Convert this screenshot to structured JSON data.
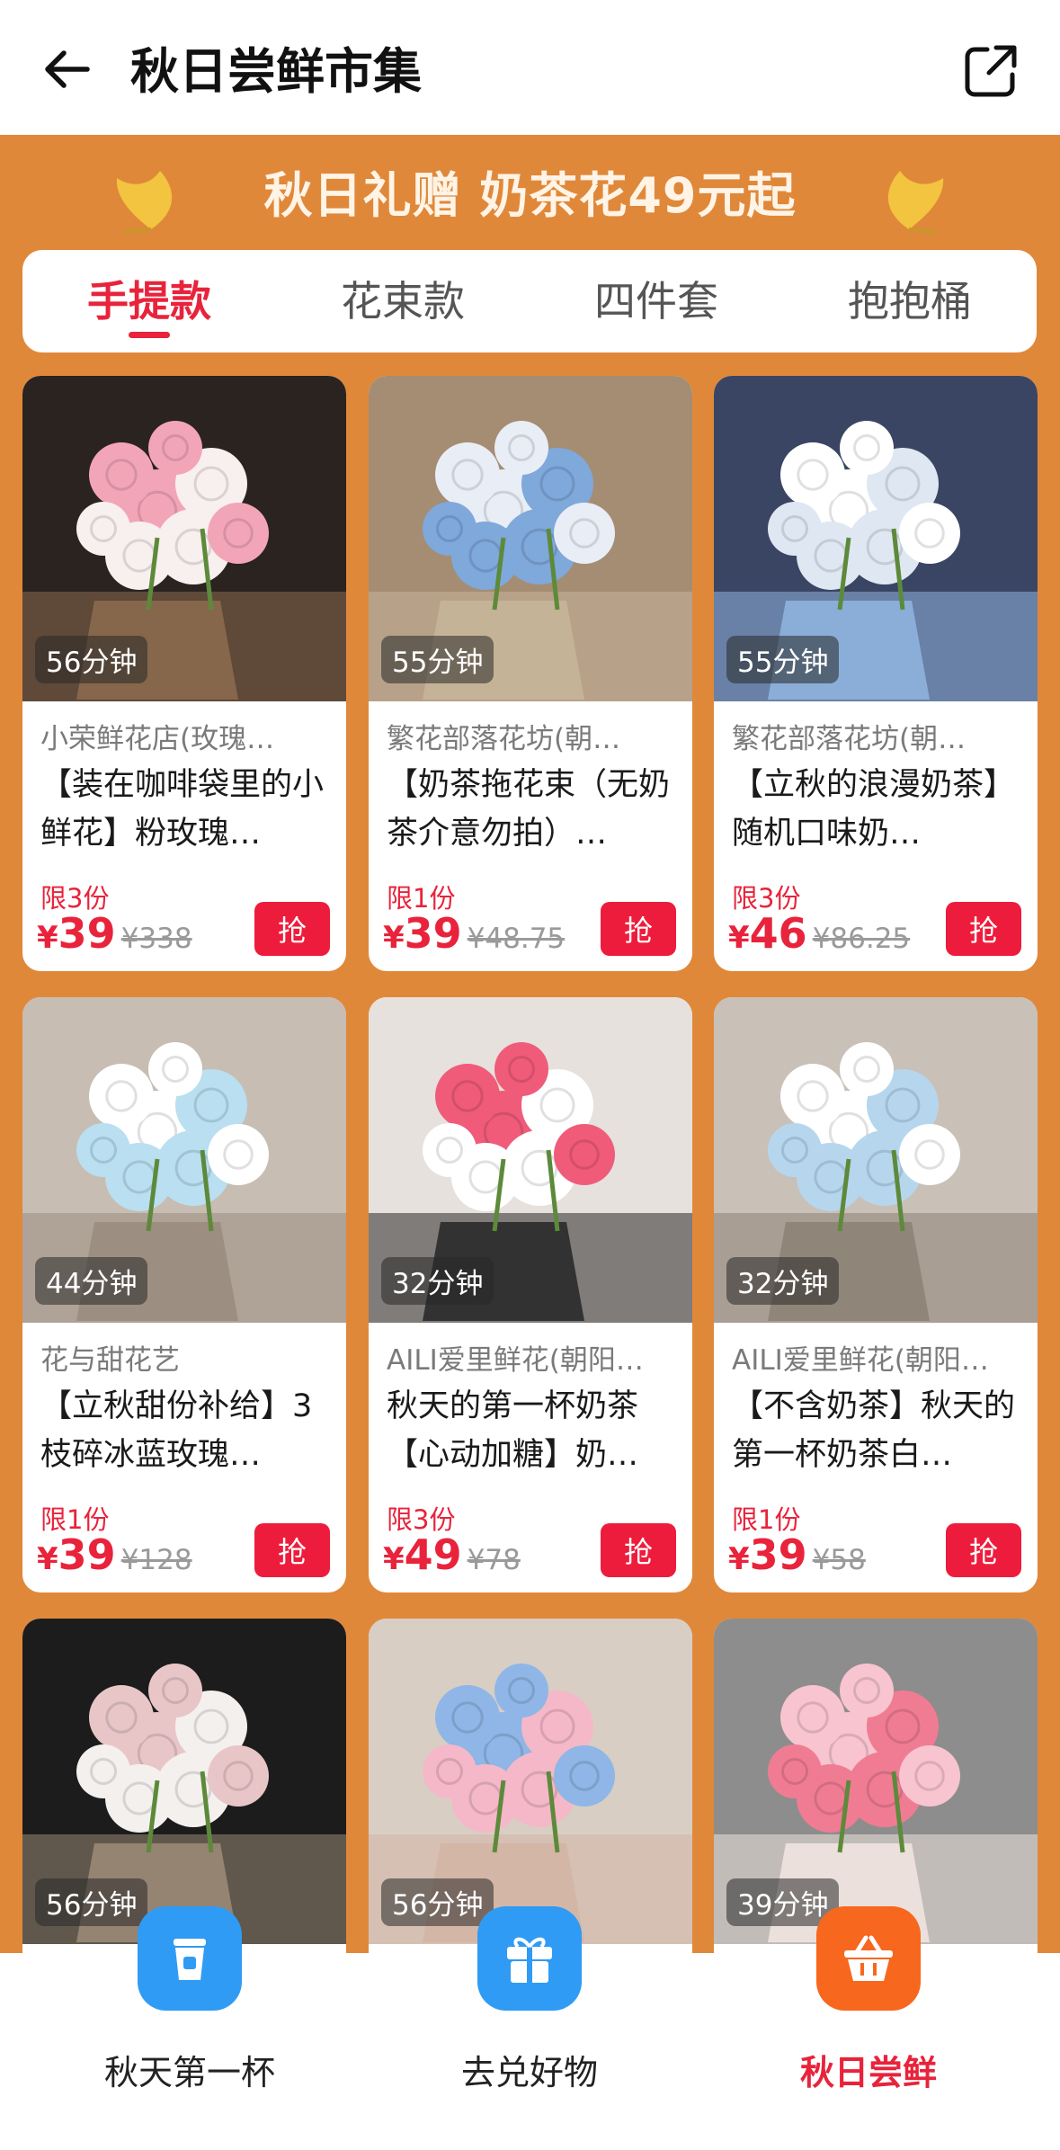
{
  "header": {
    "title": "秋日尝鲜市集",
    "back_icon": "arrow-left-icon",
    "share_icon": "share-external-icon"
  },
  "banner": {
    "text": "秋日礼赠 奶茶花49元起",
    "decor_icon": "ginkgo-leaf-icon"
  },
  "tabs": [
    {
      "label": "手提款",
      "active": true
    },
    {
      "label": "花束款",
      "active": false
    },
    {
      "label": "四件套",
      "active": false
    },
    {
      "label": "抱抱桶",
      "active": false
    }
  ],
  "products": [
    {
      "time": "56分钟",
      "shop": "小荣鲜花店(玫瑰…",
      "desc": "【装在咖啡袋里的小鲜花】粉玫瑰…",
      "limit": "限3份",
      "yen": "¥",
      "price": "39",
      "orig": "¥338",
      "grab": "抢"
    },
    {
      "time": "55分钟",
      "shop": "繁花部落花坊(朝…",
      "desc": "【奶茶拖花束（无奶茶介意勿拍）…",
      "limit": "限1份",
      "yen": "¥",
      "price": "39",
      "orig": "¥48.75",
      "grab": "抢"
    },
    {
      "time": "55分钟",
      "shop": "繁花部落花坊(朝…",
      "desc": "【立秋的浪漫奶茶】随机口味奶…",
      "limit": "限3份",
      "yen": "¥",
      "price": "46",
      "orig": "¥86.25",
      "grab": "抢"
    },
    {
      "time": "44分钟",
      "shop": "花与甜花艺",
      "desc": "【立秋甜份补给】3枝碎冰蓝玫瑰…",
      "limit": "限1份",
      "yen": "¥",
      "price": "39",
      "orig": "¥128",
      "grab": "抢"
    },
    {
      "time": "32分钟",
      "shop": "AILI爱里鲜花(朝阳…",
      "desc": "秋天的第一杯奶茶【心动加糖】奶…",
      "limit": "限3份",
      "yen": "¥",
      "price": "49",
      "orig": "¥78",
      "grab": "抢"
    },
    {
      "time": "32分钟",
      "shop": "AILI爱里鲜花(朝阳…",
      "desc": "【不含奶茶】秋天的第一杯奶茶白…",
      "limit": "限1份",
      "yen": "¥",
      "price": "39",
      "orig": "¥58",
      "grab": "抢"
    },
    {
      "time": "56分钟"
    },
    {
      "time": "56分钟"
    },
    {
      "time": "39分钟"
    }
  ],
  "bottom_nav": [
    {
      "label": "秋天第一杯",
      "icon": "coffee-cup-icon",
      "color": "#2f9bf5",
      "active": false
    },
    {
      "label": "去兑好物",
      "icon": "gift-icon",
      "color": "#2f9bf5",
      "active": false
    },
    {
      "label": "秋日尝鲜",
      "icon": "basket-icon",
      "color": "#f7671e",
      "active": true
    }
  ],
  "colors": {
    "background": "#e0883a",
    "accent_red": "#e8233b",
    "grab_button": "#ee1c3c"
  }
}
